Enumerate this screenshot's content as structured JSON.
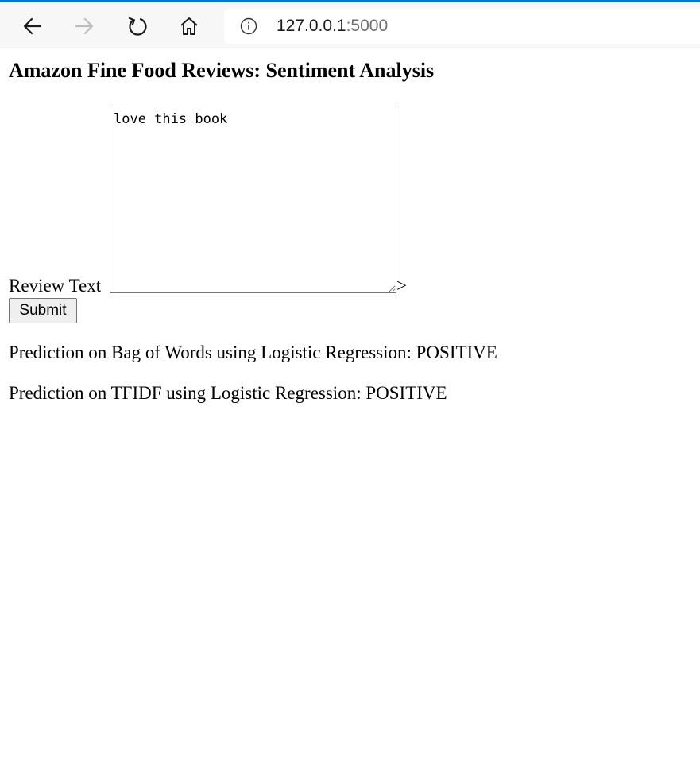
{
  "browser": {
    "url_host": "127.0.0.1",
    "url_port": ":5000",
    "accent_color": "#0a74d8",
    "icons": [
      "back-arrow-icon",
      "forward-arrow-icon",
      "refresh-icon",
      "home-icon",
      "info-icon"
    ]
  },
  "page": {
    "title": "Amazon Fine Food Reviews: Sentiment Analysis",
    "form": {
      "review_label": "Review Text",
      "review_value": "love this book",
      "stray_text": ">",
      "submit_label": "Submit"
    },
    "predictions": {
      "bow_label": "Prediction on Bag of Words using Logistic Regression: ",
      "bow_value": "POSITIVE",
      "tfidf_label": "Prediction on TFIDF using Logistic Regression: ",
      "tfidf_value": "POSITIVE"
    }
  }
}
